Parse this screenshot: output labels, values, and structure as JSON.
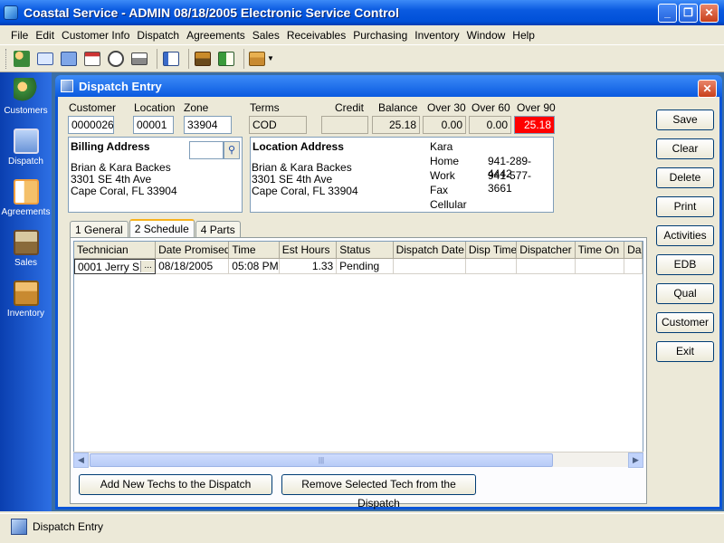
{
  "app": {
    "title": "Coastal Service - ADMIN 08/18/2005 Electronic Service Control"
  },
  "menu": [
    "File",
    "Edit",
    "Customer Info",
    "Dispatch",
    "Agreements",
    "Sales",
    "Receivables",
    "Purchasing",
    "Inventory",
    "Window",
    "Help"
  ],
  "sidebar": {
    "items": [
      {
        "label": "Customers"
      },
      {
        "label": "Dispatch"
      },
      {
        "label": "Agreements"
      },
      {
        "label": "Sales"
      },
      {
        "label": "Inventory"
      }
    ]
  },
  "dispatch": {
    "title": "Dispatch Entry",
    "labels": {
      "customer": "Customer",
      "location": "Location",
      "zone": "Zone",
      "terms": "Terms",
      "credit": "Credit",
      "balance": "Balance",
      "over30": "Over 30",
      "over60": "Over 60",
      "over90": "Over 90"
    },
    "values": {
      "customer": "0000026",
      "location": "00001",
      "zone": "33904",
      "terms": "COD",
      "credit": "",
      "balance": "25.18",
      "over30": "0.00",
      "over60": "0.00",
      "over90": "25.18"
    },
    "billing": {
      "heading": "Billing Address",
      "line1": "Brian & Kara Backes",
      "line2": "3301 SE 4th Ave",
      "line3": "Cape Coral, FL  33904",
      "search_value": ""
    },
    "location": {
      "heading": "Location Address",
      "line1": "Brian & Kara Backes",
      "line2": "3301 SE 4th Ave",
      "line3": "Cape Coral, FL  33904",
      "contact": "Kara",
      "home_label": "Home",
      "home": "941-289-4442",
      "work_label": "Work",
      "work": "941-577-3661",
      "fax_label": "Fax",
      "fax": "",
      "cell_label": "Cellular",
      "cell": ""
    },
    "tabs": [
      "1 General",
      "2 Schedule",
      "4 Parts"
    ],
    "columns": [
      "Technician",
      "Date Promised",
      "Time",
      "Est Hours",
      "Status",
      "Dispatch Date",
      "Disp Time",
      "Dispatcher",
      "Time On",
      "Da"
    ],
    "rows": [
      {
        "technician": "0001 Jerry S",
        "ellipsis": "...",
        "date_promised": "08/18/2005",
        "time": "05:08 PM",
        "est_hours": "1.33",
        "status": "Pending",
        "dispatch_date": "",
        "disp_time": "",
        "dispatcher": "",
        "time_on": "",
        "da": ""
      }
    ],
    "add_tech": "Add New Techs to the Dispatch",
    "remove_tech": "Remove Selected Tech from the Dispatch",
    "buttons": [
      "Save",
      "Clear",
      "Delete",
      "Print",
      "Activities",
      "EDB",
      "Qual",
      "Customer",
      "Exit"
    ]
  },
  "taskbar": {
    "item": "Dispatch Entry"
  },
  "colors": {
    "title_blue": "#0a5ae0",
    "over90_red": "#ff0000",
    "sidebar_blue": "#1f5bd6"
  }
}
